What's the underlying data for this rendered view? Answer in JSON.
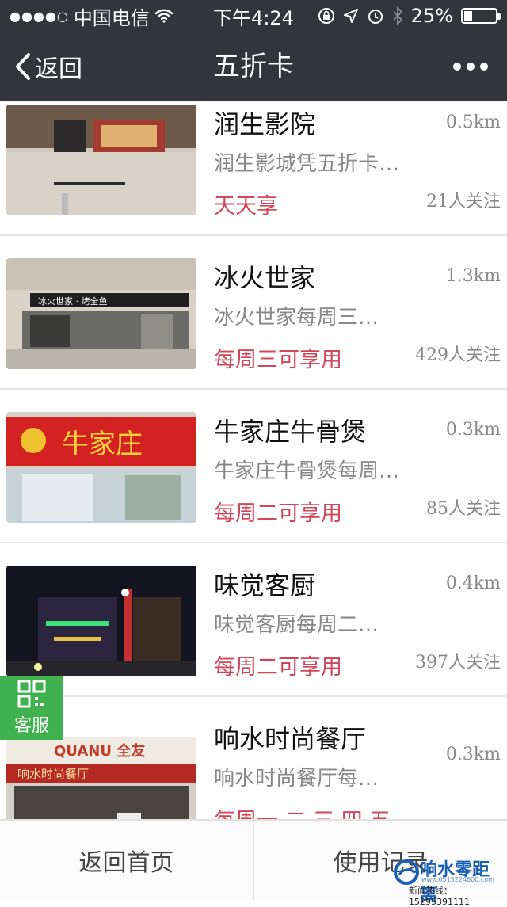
{
  "status": {
    "carrier": "中国电信",
    "time": "下午4:24",
    "battery": "25%",
    "battery_level": 0.25
  },
  "nav": {
    "back": "返回",
    "title": "五折卡"
  },
  "items": [
    {
      "name": "润生影院",
      "distance": "0.5km",
      "desc": "润生影城凭五折卡…",
      "tag": "天天享",
      "followers": "21人关注"
    },
    {
      "name": "冰火世家",
      "distance": "1.3km",
      "desc": "冰火世家每周三…",
      "tag": "每周三可享用",
      "followers": "429人关注"
    },
    {
      "name": "牛家庄牛骨煲",
      "distance": "0.3km",
      "desc": "牛家庄牛骨煲每周…",
      "tag": "每周二可享用",
      "followers": "85人关注"
    },
    {
      "name": "味觉客厨",
      "distance": "0.4km",
      "desc": "味觉客厨每周二…",
      "tag": "每周二可享用",
      "followers": "397人关注"
    },
    {
      "name": "响水时尚餐厅",
      "distance": "0.3km",
      "desc": "响水时尚餐厅每…",
      "tag": "每周一 二 三 四 五",
      "followers": ""
    }
  ],
  "images": {
    "shop3_sign": "牛家庄",
    "shop2_sign": "冰火世家 · 烤全鱼",
    "shop5_sign": "响水时尚餐厅",
    "shop5_brand": "QUANU 全友"
  },
  "service": {
    "label": "客服"
  },
  "tabbar": {
    "home": "返回首页",
    "records": "使用记录"
  },
  "watermark": {
    "name": "响水零距离",
    "url": "www.0515224600.com",
    "hotline": "新闻热线：15295391111"
  },
  "colors": {
    "bar": "#34353a",
    "tag": "#d2465a",
    "service": "#3fb24f"
  }
}
